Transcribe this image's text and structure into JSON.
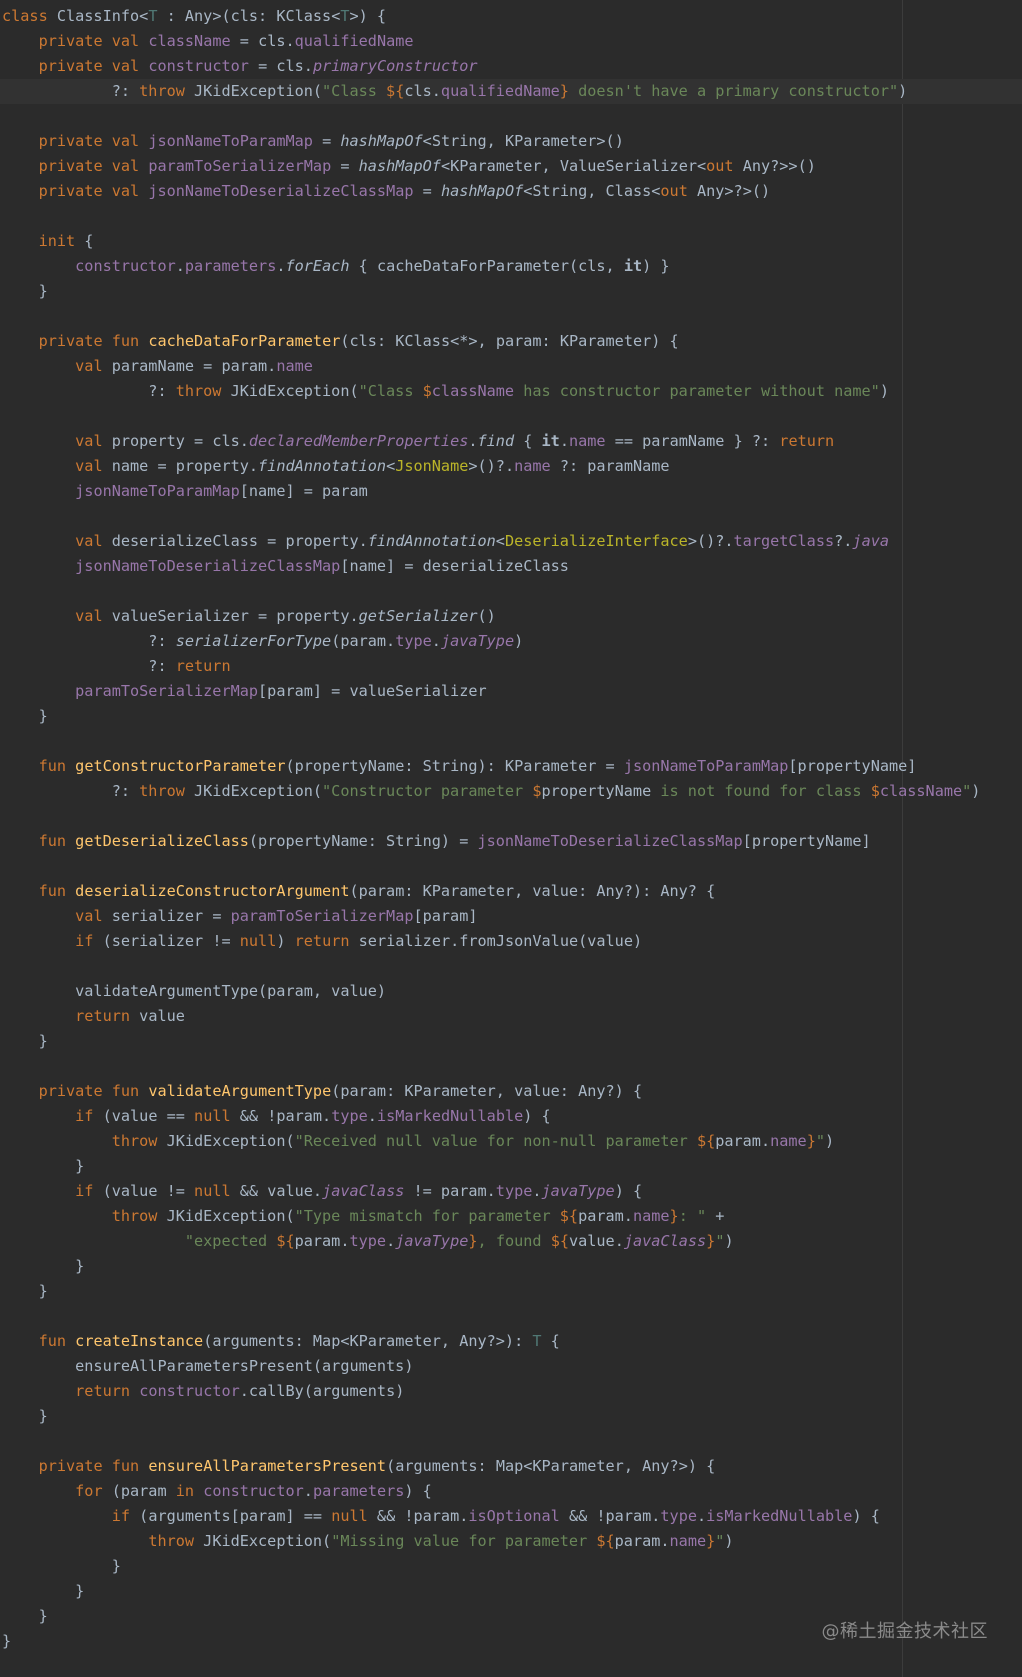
{
  "editor": {
    "language": "Kotlin",
    "theme": "Darcula",
    "colors": {
      "background": "#2b2b2b",
      "keyword": "#cc7832",
      "function": "#ffc66d",
      "property": "#9876aa",
      "string": "#6a8759",
      "default": "#a9b7c6"
    },
    "lines": [
      "class ClassInfo<T : Any>(cls: KClass<T>) {",
      "    private val className = cls.qualifiedName",
      "    private val constructor = cls.primaryConstructor",
      "            ?: throw JKidException(\"Class ${cls.qualifiedName} doesn't have a primary constructor\")",
      "",
      "    private val jsonNameToParamMap = hashMapOf<String, KParameter>()",
      "    private val paramToSerializerMap = hashMapOf<KParameter, ValueSerializer<out Any?>>()",
      "    private val jsonNameToDeserializeClassMap = hashMapOf<String, Class<out Any>?>()",
      "",
      "    init {",
      "        constructor.parameters.forEach { cacheDataForParameter(cls, it) }",
      "    }",
      "",
      "    private fun cacheDataForParameter(cls: KClass<*>, param: KParameter) {",
      "        val paramName = param.name",
      "                ?: throw JKidException(\"Class $className has constructor parameter without name\")",
      "",
      "        val property = cls.declaredMemberProperties.find { it.name == paramName } ?: return",
      "        val name = property.findAnnotation<JsonName>()?.name ?: paramName",
      "        jsonNameToParamMap[name] = param",
      "",
      "        val deserializeClass = property.findAnnotation<DeserializeInterface>()?.targetClass?.java",
      "        jsonNameToDeserializeClassMap[name] = deserializeClass",
      "",
      "        val valueSerializer = property.getSerializer()",
      "                ?: serializerForType(param.type.javaType)",
      "                ?: return",
      "        paramToSerializerMap[param] = valueSerializer",
      "    }",
      "",
      "    fun getConstructorParameter(propertyName: String): KParameter = jsonNameToParamMap[propertyName]",
      "            ?: throw JKidException(\"Constructor parameter $propertyName is not found for class $className\")",
      "",
      "    fun getDeserializeClass(propertyName: String) = jsonNameToDeserializeClassMap[propertyName]",
      "",
      "    fun deserializeConstructorArgument(param: KParameter, value: Any?): Any? {",
      "        val serializer = paramToSerializerMap[param]",
      "        if (serializer != null) return serializer.fromJsonValue(value)",
      "",
      "        validateArgumentType(param, value)",
      "        return value",
      "    }",
      "",
      "    private fun validateArgumentType(param: KParameter, value: Any?) {",
      "        if (value == null && !param.type.isMarkedNullable) {",
      "            throw JKidException(\"Received null value for non-null parameter ${param.name}\")",
      "        }",
      "        if (value != null && value.javaClass != param.type.javaType) {",
      "            throw JKidException(\"Type mismatch for parameter ${param.name}: \" +",
      "                    \"expected ${param.type.javaType}, found ${value.javaClass}\")",
      "        }",
      "    }",
      "",
      "    fun createInstance(arguments: Map<KParameter, Any?>): T {",
      "        ensureAllParametersPresent(arguments)",
      "        return constructor.callBy(arguments)",
      "    }",
      "",
      "    private fun ensureAllParametersPresent(arguments: Map<KParameter, Any?>) {",
      "        for (param in constructor.parameters) {",
      "            if (arguments[param] == null && !param.isOptional && !param.type.isMarkedNullable) {",
      "                throw JKidException(\"Missing value for parameter ${param.name}\")",
      "            }",
      "        }",
      "    }",
      "}"
    ]
  },
  "watermark": "@稀土掘金技术社区"
}
